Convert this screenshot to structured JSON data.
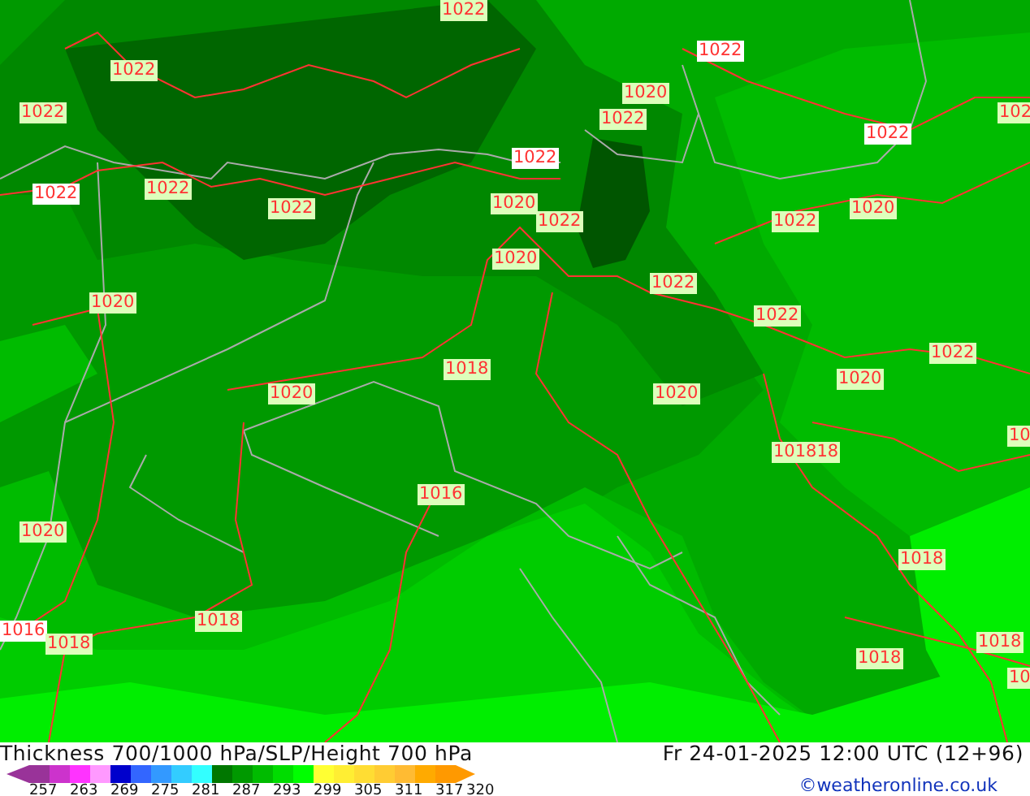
{
  "map": {
    "isobar_labels": [
      {
        "text": "1022",
        "color": "#ddffbb"
      },
      {
        "text": "1022",
        "color": "#ffffff"
      },
      {
        "text": "1022",
        "color": "#ddffbb"
      },
      {
        "text": "1020",
        "color": "#ddffbb"
      },
      {
        "text": "1022",
        "color": "#ddffbb"
      },
      {
        "text": "1022",
        "color": "#ddffbb"
      },
      {
        "text": "1022",
        "color": "#ffffff"
      },
      {
        "text": "102",
        "color": "#ddffbb"
      },
      {
        "text": "1022",
        "color": "#ffffff"
      },
      {
        "text": "1022",
        "color": "#ffffff"
      },
      {
        "text": "1022",
        "color": "#ddffbb"
      },
      {
        "text": "1022",
        "color": "#ddffbb"
      },
      {
        "text": "1020",
        "color": "#ddffbb"
      },
      {
        "text": "1022",
        "color": "#ddffbb"
      },
      {
        "text": "1022",
        "color": "#ddffbb"
      },
      {
        "text": "1020",
        "color": "#ddffbb"
      },
      {
        "text": "1020",
        "color": "#ddffbb"
      },
      {
        "text": "1022",
        "color": "#ddffbb"
      },
      {
        "text": "1020",
        "color": "#ddffbb"
      },
      {
        "text": "1022",
        "color": "#ddffbb"
      },
      {
        "text": "1022",
        "color": "#ddffbb"
      },
      {
        "text": "1018",
        "color": "#ddffbb"
      },
      {
        "text": "1020",
        "color": "#ddffbb"
      },
      {
        "text": "1020",
        "color": "#ddffbb"
      },
      {
        "text": "1020",
        "color": "#ddffbb"
      },
      {
        "text": "10",
        "color": "#ddffbb"
      },
      {
        "text": "101818",
        "color": "#ddffbb"
      },
      {
        "text": "1016",
        "color": "#ddffbb"
      },
      {
        "text": "1020",
        "color": "#ddffbb"
      },
      {
        "text": "1018",
        "color": "#ddffbb"
      },
      {
        "text": "1016",
        "color": "#ffffff"
      },
      {
        "text": "1018",
        "color": "#ddffbb"
      },
      {
        "text": "1018",
        "color": "#ddffbb"
      },
      {
        "text": "1018",
        "color": "#ddffbb"
      },
      {
        "text": "1018",
        "color": "#ddffbb"
      },
      {
        "text": "10",
        "color": "#ddffbb"
      }
    ]
  },
  "footer": {
    "title": "Thickness 700/1000 hPa/SLP/Height 700 hPa",
    "valid_time": "Fr 24-01-2025 12:00 UTC (12+96)",
    "credit": "©weatheronline.co.uk",
    "legend": {
      "colors": [
        {
          "color": "#993399"
        },
        {
          "color": "#cc33cc"
        },
        {
          "color": "#ff33ff"
        },
        {
          "color": "#ff99ff"
        },
        {
          "color": "#0000cc"
        },
        {
          "color": "#3366ff"
        },
        {
          "color": "#3399ff"
        },
        {
          "color": "#33ccff"
        },
        {
          "color": "#33ffff"
        },
        {
          "color": "#007700"
        },
        {
          "color": "#009900"
        },
        {
          "color": "#00bb00"
        },
        {
          "color": "#00dd00"
        },
        {
          "color": "#00ff00"
        },
        {
          "color": "#ffff33"
        },
        {
          "color": "#ffee33"
        },
        {
          "color": "#ffdd33"
        },
        {
          "color": "#ffcc33"
        },
        {
          "color": "#ffbb33"
        },
        {
          "color": "#ffaa00"
        },
        {
          "color": "#ff9900"
        }
      ],
      "ticks": [
        "257",
        "263",
        "269",
        "275",
        "281",
        "287",
        "293",
        "299",
        "305",
        "311",
        "317",
        "320"
      ]
    }
  }
}
